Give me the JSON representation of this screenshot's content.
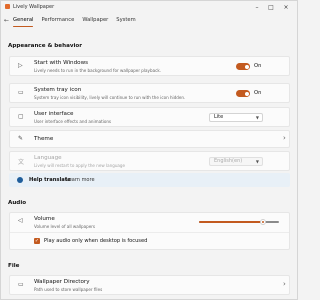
{
  "window": {
    "title": "Lively Wallpaper"
  },
  "tabs": [
    {
      "label": "General"
    },
    {
      "label": "Performance"
    },
    {
      "label": "Wallpaper"
    },
    {
      "label": "System"
    }
  ],
  "appearance": {
    "section_title": "Appearance & behavior",
    "start_with_windows": {
      "title": "Start with Windows",
      "desc": "Lively needs to run in the background for wallpaper playback.",
      "state": "On"
    },
    "system_tray": {
      "title": "System tray icon",
      "desc": "System tray icon visibility, lively will continue to run with the icon hidden.",
      "state": "On"
    },
    "user_interface": {
      "title": "User interface",
      "desc": "User interface effects and animations",
      "value": "Lite"
    },
    "theme": {
      "title": "Theme"
    },
    "language": {
      "title": "Language",
      "desc": "Lively will restart to apply the new language",
      "value": "English(en)"
    },
    "help_translate": {
      "title": "Help translate",
      "link": "Learn more"
    }
  },
  "audio": {
    "section_title": "Audio",
    "volume": {
      "title": "Volume",
      "desc": "Volume level of all wallpapers",
      "level": 0.8
    },
    "desktop_focus": {
      "label": "Play audio only when desktop is focused",
      "checked": true
    }
  },
  "file": {
    "section_title": "File",
    "wallpaper_directory": {
      "title": "Wallpaper Directory",
      "desc": "Path used to store wallpaper files"
    }
  },
  "colors": {
    "accent": "#c35a1f",
    "info_bg": "#e8f0f7",
    "info_icon": "#1f5e9b"
  }
}
